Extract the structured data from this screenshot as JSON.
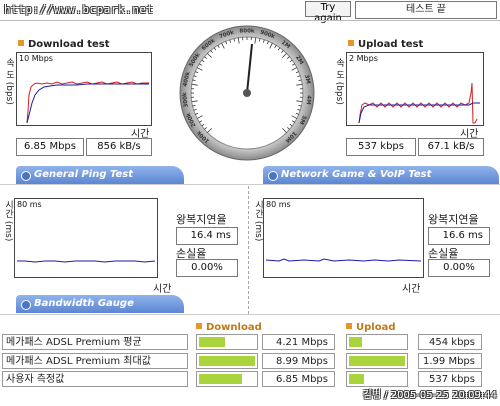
{
  "header": {
    "site": "http://www.bcpark.net",
    "try_again": "Try again",
    "end_test": "테스트 끝"
  },
  "download": {
    "title": "Download test",
    "axis_top": "10 Mbps",
    "ylabel": "속 도 (bps)",
    "xlabel": "시간",
    "mbps": "6.85 Mbps",
    "kbs": "856 kB/s"
  },
  "upload": {
    "title": "Upload test",
    "axis_top": "2 Mbps",
    "ylabel": "속 도 (bps)",
    "xlabel": "시간",
    "kbps": "537 kbps",
    "kbs": "67.1 kB/s"
  },
  "gauge": {
    "ticks": [
      "100k",
      "200k",
      "300k",
      "400k",
      "500k",
      "600k",
      "700k",
      "800k",
      "900k",
      "1M",
      "2M",
      "3M",
      "4M",
      "5M",
      "10M"
    ]
  },
  "tabs": {
    "ping": "General Ping Test",
    "game": "Network Game & VoIP Test",
    "bandwidth": "Bandwidth Gauge"
  },
  "ping": {
    "left": {
      "axis_top": "80 ms",
      "ylabel": "시간 (ms)",
      "xlabel": "시간",
      "rtt_label": "왕복지연율",
      "rtt": "16.4 ms",
      "loss_label": "손실율",
      "loss": "0.00%"
    },
    "right": {
      "axis_top": "80 ms",
      "ylabel": "시간 (ms)",
      "xlabel": "시간",
      "rtt_label": "왕복지연율",
      "rtt": "16.6 ms",
      "loss_label": "손실율",
      "loss": "0.00%"
    }
  },
  "bandwidth": {
    "download_header": "Download",
    "upload_header": "Upload",
    "rows": [
      {
        "label": "메가패스 ADSL Premium 평균",
        "down": "4.21 Mbps",
        "down_frac": 0.47,
        "up": "454 kbps",
        "up_frac": 0.23
      },
      {
        "label": "메가패스 ADSL Premium 최대값",
        "down": "8.99 Mbps",
        "down_frac": 1.0,
        "up": "1.99 Mbps",
        "up_frac": 1.0
      },
      {
        "label": "사용자 측정값",
        "down": "6.85 Mbps",
        "down_frac": 0.76,
        "up": "537 kbps",
        "up_frac": 0.27
      }
    ]
  },
  "footer": "김병 / 2005-05-25 20:09:44",
  "colors": {
    "download_line": "#d42020",
    "download_line2": "#1a1aa8",
    "tab_blue": "#6a8fd8",
    "bar_green": "#a9d43c",
    "accent_orange": "#e8952a"
  }
}
